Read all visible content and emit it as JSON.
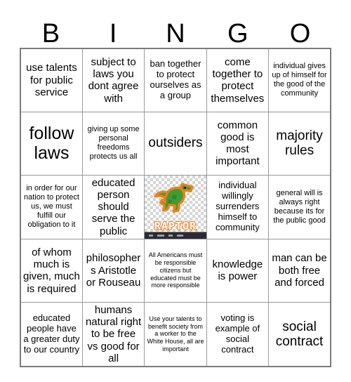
{
  "header": {
    "letters": [
      "B",
      "I",
      "N",
      "G",
      "O"
    ]
  },
  "colors": {
    "background": "#ffffff",
    "text": "#000000",
    "grid_outer_border": "#7b7b7b",
    "grid_cell_border": "#9a9a9a",
    "checker_light": "#ffffff",
    "checker_dark": "#d4d4d4",
    "raptor_body_green": "#3f9c35",
    "raptor_shadow_green": "#2b6f26",
    "raptor_outline_orange": "#f07f1a",
    "raptor_text_white": "#ffffff",
    "free_bar_dark": "#2b2b33"
  },
  "grid": {
    "rows": [
      [
        {
          "text": "use talents for public service",
          "size": "md"
        },
        {
          "text": "subject to laws you dont agree with",
          "size": "md"
        },
        {
          "text": "ban together to protect ourselves as a group",
          "size": "sm"
        },
        {
          "text": "come together to protect themselves",
          "size": "md"
        },
        {
          "text": "individual gives up of himself for the good of the community",
          "size": "xs"
        }
      ],
      [
        {
          "text": "follow laws",
          "size": "xl"
        },
        {
          "text": "giving up some personal freedoms protects us all",
          "size": "xs"
        },
        {
          "text": "outsiders",
          "size": "lg"
        },
        {
          "text": "common good is most important",
          "size": "md"
        },
        {
          "text": "majority rules",
          "size": "lg"
        }
      ],
      [
        {
          "text": "in order for our nation to protect us, we must fulfill our obligation to it",
          "size": "xs"
        },
        {
          "text": "educated person should serve the public",
          "size": "md"
        },
        {
          "free_space": true,
          "icon": "raptor-mascot-icon",
          "alt": "RAPTOR",
          "wordmark": "RAPTOR"
        },
        {
          "text": "individual willingly surrenders himself to community",
          "size": "sm"
        },
        {
          "text": "general will is always right because its for the public good",
          "size": "xs"
        }
      ],
      [
        {
          "text": "of whom much is given, much is required",
          "size": "md"
        },
        {
          "text": "philosophers Aristotle or Rouseau",
          "size": "md"
        },
        {
          "text": "All Americans must be responsible citizens but educated must be more responsible",
          "size": "xxs"
        },
        {
          "text": "knowledge is power",
          "size": "md"
        },
        {
          "text": "man can be both free and forced",
          "size": "md"
        }
      ],
      [
        {
          "text": "educated people have a greater duty to our country",
          "size": "sm"
        },
        {
          "text": "humans natural right to be free vs good for all",
          "size": "md"
        },
        {
          "text": "Use your talents to benefit society from a worker to the White House, all are important",
          "size": "xxs"
        },
        {
          "text": "voting is example of social contract",
          "size": "sm"
        },
        {
          "text": "social contract",
          "size": "lg"
        }
      ]
    ]
  }
}
